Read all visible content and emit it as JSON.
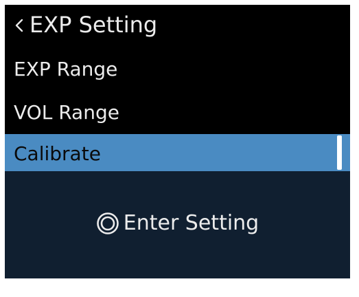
{
  "header": {
    "title": "EXP Setting",
    "back_icon": "chevron-left-icon"
  },
  "menu": {
    "items": [
      {
        "label": "EXP Range",
        "selected": false
      },
      {
        "label": "VOL Range",
        "selected": false
      },
      {
        "label": "Calibrate",
        "selected": true
      }
    ]
  },
  "hint": {
    "icon": "knob-press-icon",
    "label": "Enter Setting"
  },
  "colors": {
    "background": "#000000",
    "selected": "#4a8bc2",
    "bottom_panel": "#101f30",
    "text": "#ececec"
  }
}
